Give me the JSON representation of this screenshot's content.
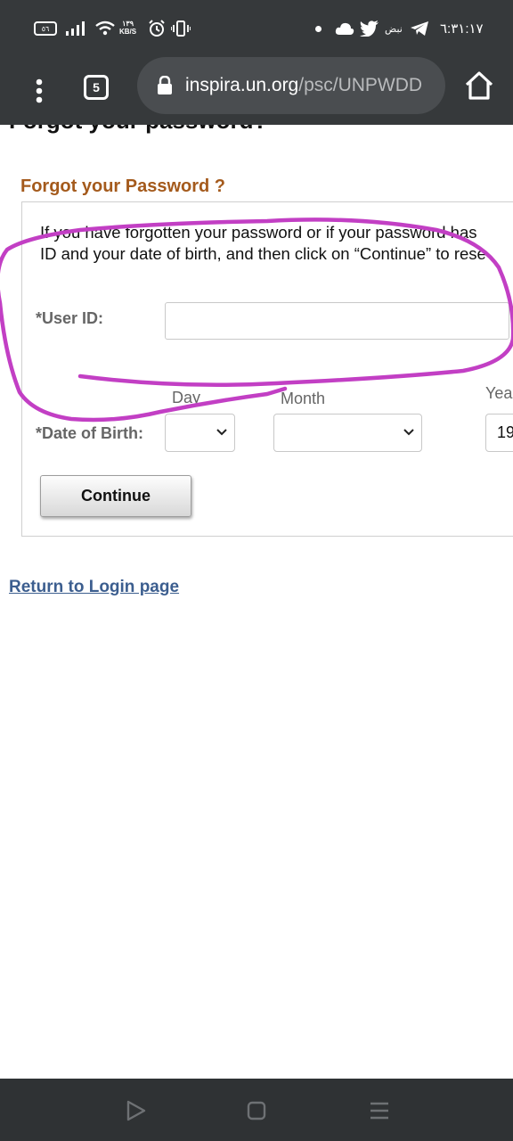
{
  "status_bar": {
    "battery": "٥٦",
    "net_speed_value": "١٣٩",
    "net_speed_unit": "KB/S",
    "carrier_text": "نبض",
    "time": "٦:٣١:١٧"
  },
  "browser": {
    "tab_count": "5",
    "url_domain": "inspira.un.org",
    "url_path": "/psc/UNPWDD"
  },
  "page": {
    "heading_partial": "Forgot your password?",
    "section_title": "Forgot your Password ?",
    "instructions_line1": "If you have forgotten your password or if your password has",
    "instructions_line2": "ID and your date of birth, and then click on “Continue” to rese",
    "user_id_label": "*User ID:",
    "user_id_value": "",
    "dob_label": "*Date of Birth:",
    "day_label": "Day",
    "month_label": "Month",
    "year_label": "Yea",
    "day_value": "",
    "month_value": "",
    "year_value": "19",
    "continue_label": "Continue",
    "return_link": "Return to Login page"
  },
  "annotation_color": "#c23fc4",
  "icons": {
    "status": [
      "battery-icon",
      "signal-icon",
      "wifi-icon",
      "alarm-icon",
      "vibrate-icon",
      "dot-icon",
      "cloud-icon",
      "twitter-icon",
      "telegram-icon"
    ],
    "nav": [
      "back-icon",
      "home-nav-icon",
      "recents-icon"
    ]
  }
}
